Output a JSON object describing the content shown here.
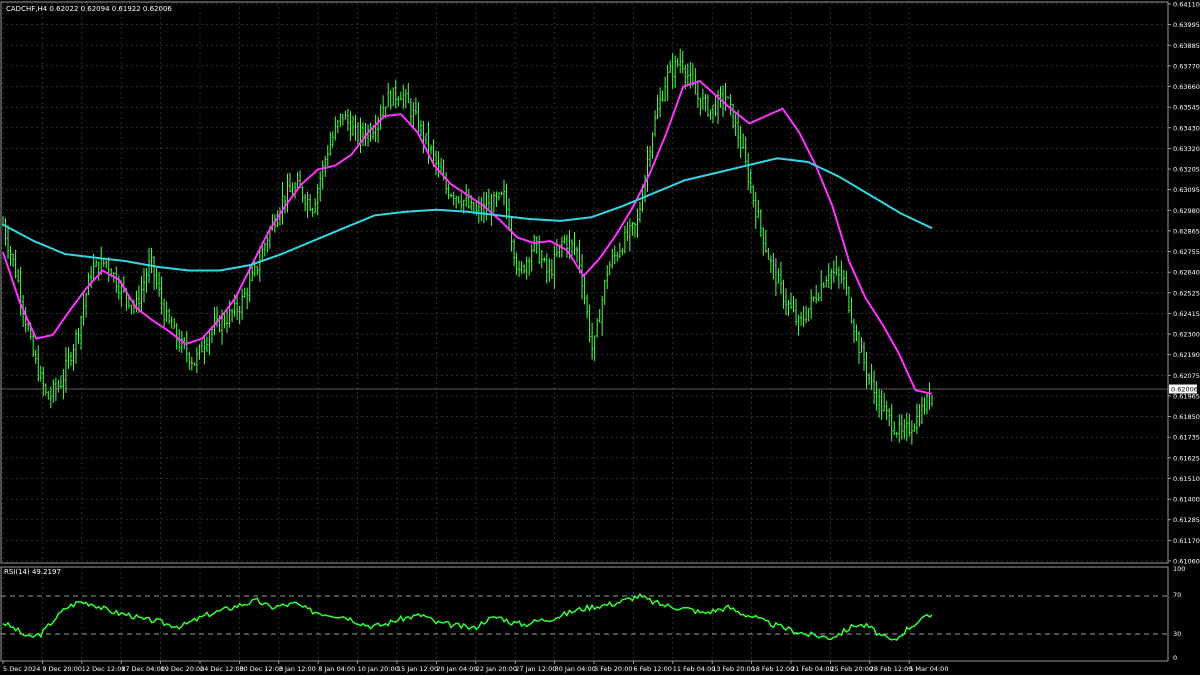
{
  "header": {
    "symbol_line": "CADCHF,H4  0.62022 0.62094 0.61922 0.62006",
    "rsi_label": "RSI(14) 49.2197"
  },
  "colors": {
    "background": "#000000",
    "grid": "#3a3a3a",
    "candles": "#4cff4c",
    "ma_fast": "#ff33ff",
    "ma_slow": "#33d6e6",
    "rsi_line": "#33ff33",
    "axis_text": "#ffffff"
  },
  "chart_data": [
    {
      "type": "candlestick",
      "title": "CADCHF,H4",
      "current_price_label": "0.62006",
      "ylim": [
        0.6106,
        0.6411
      ],
      "yticks": [
        "0.64110",
        "0.63995",
        "0.63885",
        "0.63770",
        "0.63660",
        "0.63545",
        "0.63430",
        "0.63320",
        "0.63205",
        "0.63095",
        "0.62980",
        "0.62865",
        "0.62755",
        "0.62640",
        "0.62525",
        "0.62415",
        "0.62300",
        "0.62190",
        "0.62075",
        "0.61965",
        "0.61850",
        "0.61735",
        "0.61625",
        "0.61510",
        "0.61400",
        "0.61285",
        "0.61170",
        "0.61060"
      ],
      "xticks": [
        "5 Dec 2024",
        "9 Dec 20:00",
        "12 Dec 12:00",
        "17 Dec 04:00",
        "19 Dec 20:00",
        "24 Dec 12:00",
        "30 Dec 12:00",
        "3 Jan 12:00",
        "8 Jan 04:00",
        "10 Jan 20:00",
        "15 Jan 12:00",
        "20 Jan 04:00",
        "22 Jan 20:00",
        "27 Jan 12:00",
        "30 Jan 04:00",
        "3 Feb 20:00",
        "6 Feb 12:00",
        "11 Feb 04:00",
        "13 Feb 20:00",
        "18 Feb 12:00",
        "21 Feb 04:00",
        "25 Feb 20:00",
        "28 Feb 12:00",
        "5 Mar 04:00"
      ],
      "price_path": [
        0.629,
        0.626,
        0.622,
        0.6195,
        0.6205,
        0.623,
        0.6265,
        0.627,
        0.6255,
        0.6245,
        0.627,
        0.624,
        0.6225,
        0.6215,
        0.6232,
        0.6238,
        0.6245,
        0.6262,
        0.6285,
        0.6305,
        0.631,
        0.63,
        0.633,
        0.635,
        0.6338,
        0.6342,
        0.6358,
        0.6362,
        0.6347,
        0.633,
        0.631,
        0.6305,
        0.6296,
        0.63,
        0.6305,
        0.6262,
        0.628,
        0.6262,
        0.6282,
        0.6275,
        0.622,
        0.6266,
        0.628,
        0.629,
        0.634,
        0.637,
        0.638,
        0.636,
        0.6352,
        0.636,
        0.6335,
        0.63,
        0.627,
        0.625,
        0.6235,
        0.625,
        0.6265,
        0.626,
        0.6225,
        0.62,
        0.6185,
        0.6175,
        0.6185,
        0.6198
      ],
      "ma_fast_path": [
        0.6275,
        0.6248,
        0.6228,
        0.623,
        0.6243,
        0.6255,
        0.6265,
        0.626,
        0.6245,
        0.6238,
        0.6232,
        0.6225,
        0.6228,
        0.6238,
        0.625,
        0.6268,
        0.6286,
        0.63,
        0.6312,
        0.632,
        0.6322,
        0.6328,
        0.634,
        0.6349,
        0.635,
        0.634,
        0.6322,
        0.6312,
        0.6306,
        0.63,
        0.6292,
        0.6283,
        0.628,
        0.6281,
        0.6276,
        0.6262,
        0.6272,
        0.6285,
        0.63,
        0.6318,
        0.634,
        0.6365,
        0.6368,
        0.636,
        0.6352,
        0.6345,
        0.6349,
        0.6353,
        0.634,
        0.6322,
        0.63,
        0.627,
        0.625,
        0.6236,
        0.622,
        0.62,
        0.6198
      ],
      "ma_slow_path": [
        0.629,
        0.6281,
        0.6274,
        0.6272,
        0.627,
        0.6267,
        0.6265,
        0.6265,
        0.6268,
        0.6274,
        0.6281,
        0.6288,
        0.6295,
        0.6297,
        0.6298,
        0.6297,
        0.6295,
        0.6293,
        0.6292,
        0.6294,
        0.63,
        0.6307,
        0.6314,
        0.6318,
        0.6322,
        0.6326,
        0.6324,
        0.6316,
        0.6306,
        0.6296,
        0.6288
      ]
    },
    {
      "type": "line",
      "title": "RSI(14) 49.2197",
      "ylim": [
        0,
        100
      ],
      "yticks": [
        "100",
        "70",
        "30",
        "0"
      ],
      "levels": [
        70,
        30
      ],
      "values": [
        42,
        35,
        26,
        30,
        45,
        58,
        64,
        62,
        56,
        52,
        50,
        45,
        44,
        40,
        38,
        44,
        50,
        54,
        58,
        62,
        65,
        58,
        60,
        62,
        55,
        52,
        50,
        48,
        42,
        38,
        40,
        45,
        48,
        50,
        42,
        40,
        38,
        36,
        45,
        48,
        42,
        40,
        44,
        46,
        50,
        55,
        58,
        60,
        62,
        66,
        70,
        64,
        60,
        58,
        56,
        52,
        55,
        58,
        52,
        48,
        42,
        38,
        34,
        30,
        28,
        26,
        32,
        40,
        38,
        28,
        22,
        35,
        44,
        50
      ]
    }
  ]
}
